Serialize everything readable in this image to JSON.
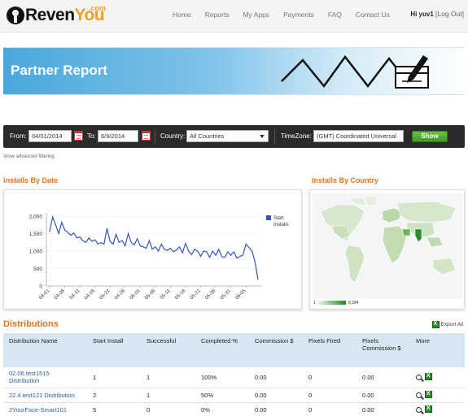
{
  "brand": {
    "name_part1": "Reven",
    "name_part2": "You",
    "suffix": ".com"
  },
  "nav": {
    "items": [
      "Home",
      "Reports",
      "My Apps",
      "Payments",
      "FAQ",
      "Contact Us"
    ]
  },
  "user": {
    "greeting": "Hi yuv1",
    "logout": "[Log Out]"
  },
  "banner": {
    "title": "Partner Report"
  },
  "filters": {
    "from_label": "From:",
    "from_value": "04/01/2014",
    "to_label": "To:",
    "to_value": "6/9/2014",
    "country_label": "Country:",
    "country_value": "All Countries",
    "timezone_label": "TimeZone:",
    "timezone_value": "(GMT) Coordinated Universal",
    "show_label": "Show",
    "advanced_link": "show advanced filtering"
  },
  "sections": {
    "installs_by_date": "Installs By Date",
    "installs_by_country": "Installs By Country",
    "distributions": "Distributions",
    "export_all": "Export All"
  },
  "map_legend": {
    "min": "1",
    "max": "8,384"
  },
  "chart_data": {
    "type": "line",
    "title": "",
    "xlabel": "",
    "ylabel": "",
    "ylim": [
      0,
      2000
    ],
    "yticks": [
      "2,000",
      "1,500",
      "1,000",
      "500",
      "0"
    ],
    "x_ticks": [
      "04-01",
      "04-06",
      "04-11",
      "04-16",
      "04-21",
      "04-26",
      "05-01",
      "05-06",
      "05-11",
      "05-16",
      "05-21",
      "05-26",
      "05-31",
      "06-05"
    ],
    "legend": "right",
    "series": [
      {
        "name": "Start Installs",
        "color": "#3355bb",
        "x": [
          "04-01",
          "04-02",
          "04-03",
          "04-04",
          "04-05",
          "04-06",
          "04-07",
          "04-08",
          "04-09",
          "04-10",
          "04-11",
          "04-12",
          "04-13",
          "04-14",
          "04-15",
          "04-16",
          "04-17",
          "04-18",
          "04-19",
          "04-20",
          "04-21",
          "04-22",
          "04-23",
          "04-24",
          "04-25",
          "04-26",
          "04-27",
          "04-28",
          "04-29",
          "04-30",
          "05-01",
          "05-02",
          "05-03",
          "05-04",
          "05-05",
          "05-06",
          "05-07",
          "05-08",
          "05-09",
          "05-10",
          "05-11",
          "05-12",
          "05-13",
          "05-14",
          "05-15",
          "05-16",
          "05-17",
          "05-18",
          "05-19",
          "05-20",
          "05-21",
          "05-22",
          "05-23",
          "05-24",
          "05-25",
          "05-26",
          "05-27",
          "05-28",
          "05-29",
          "05-30",
          "05-31",
          "06-01",
          "06-02",
          "06-03",
          "06-04",
          "06-05",
          "06-06",
          "06-07",
          "06-08",
          "06-09"
        ],
        "values": [
          1550,
          1980,
          1750,
          1500,
          1820,
          1600,
          1540,
          1450,
          1520,
          1380,
          1400,
          1300,
          1250,
          1380,
          1280,
          1320,
          1200,
          1240,
          1200,
          1650,
          1280,
          1200,
          1480,
          1250,
          1300,
          1150,
          1500,
          1250,
          1180,
          1350,
          1150,
          1120,
          1080,
          1300,
          1050,
          1120,
          1000,
          1200,
          1050,
          1020,
          1080,
          980,
          1030,
          1120,
          950,
          1220,
          1000,
          900,
          1050,
          1000,
          850,
          1000,
          980,
          820,
          1000,
          880,
          1050,
          840,
          820,
          980,
          880,
          980,
          800,
          850,
          880,
          1200,
          1100,
          1000,
          700,
          180
        ]
      }
    ]
  },
  "distributions": {
    "headers": [
      "Distribution Name",
      "Start Install",
      "Successful",
      "Completed %",
      "Commission $",
      "Pixels Fired",
      "Pixels Commission $",
      "More"
    ],
    "rows": [
      {
        "name": "02.06.test1515 Distribution",
        "start_install": "1",
        "successful": "1",
        "completed": "100%",
        "commission": "0.00",
        "pixels_fired": "0",
        "pixels_commission": "0.00"
      },
      {
        "name": "22.4 test121 Distribution",
        "start_install": "2",
        "successful": "1",
        "completed": "50%",
        "commission": "0.00",
        "pixels_fired": "0",
        "pixels_commission": "0.00"
      },
      {
        "name": "2YourFace-Smart101",
        "start_install": "5",
        "successful": "0",
        "completed": "0%",
        "commission": "0.00",
        "pixels_fired": "0",
        "pixels_commission": "0.00"
      }
    ]
  }
}
